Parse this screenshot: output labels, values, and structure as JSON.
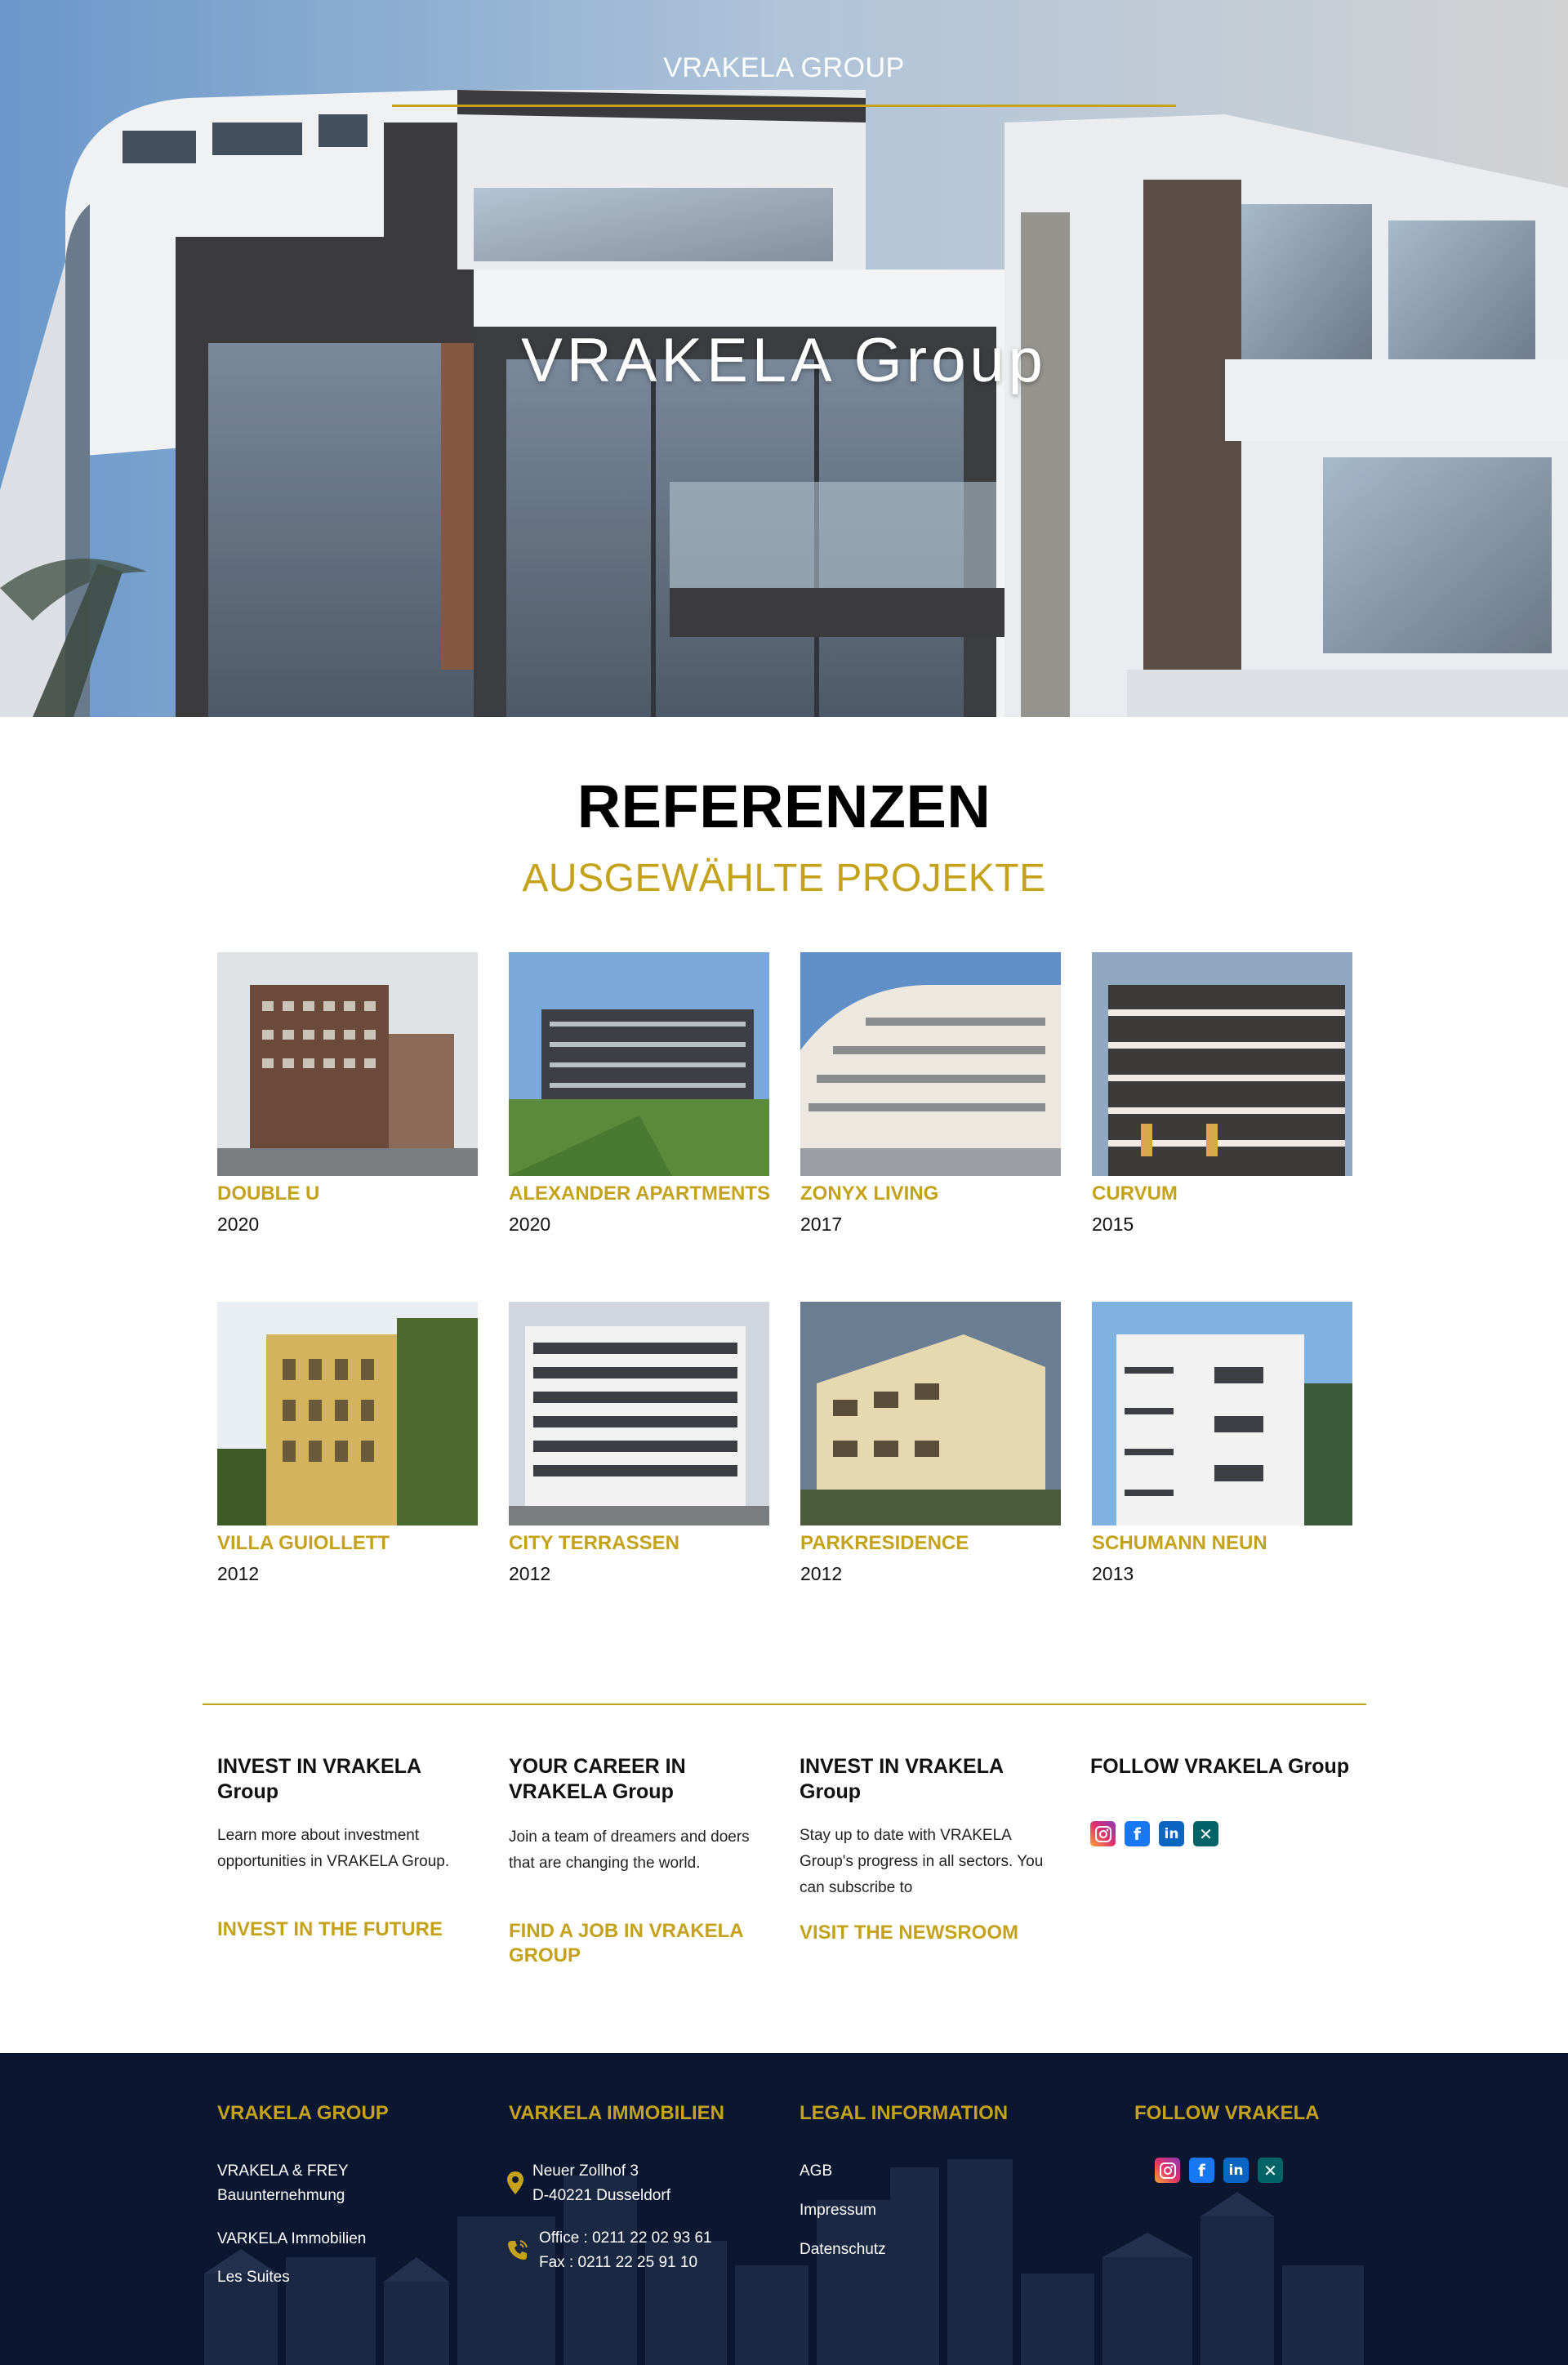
{
  "hero": {
    "brand": "VRAKELA GROUP",
    "title": "VRAKELA Group"
  },
  "references": {
    "title": "REFERENZEN",
    "subtitle": "AUSGEWÄHLTE PROJEKTE",
    "projects": [
      {
        "name": "DOUBLE U",
        "year": "2020"
      },
      {
        "name": "ALEXANDER APARTMENTS",
        "year": "2020"
      },
      {
        "name": "ZONYX LIVING",
        "year": "2017"
      },
      {
        "name": "CURVUM",
        "year": "2015"
      },
      {
        "name": "VILLA GUIOLLETT",
        "year": "2012"
      },
      {
        "name": "CITY TERRASSEN",
        "year": "2012"
      },
      {
        "name": "PARKRESIDENCE",
        "year": "2012"
      },
      {
        "name": "SCHUMANN NEUN",
        "year": "2013"
      }
    ]
  },
  "info": {
    "invest": {
      "title": "INVEST IN VRAKELA Group",
      "text": "Learn more about investment opportunities in VRAKELA Group.",
      "cta": "INVEST IN THE FUTURE"
    },
    "career": {
      "title": "YOUR CAREER IN VRAKELA Group",
      "text": "Join a team of dreamers and doers that are changing the world.",
      "cta": "FIND A JOB IN VRAKELA GROUP"
    },
    "news": {
      "title": "INVEST IN VRAKELA Group",
      "text": "Stay up to date with VRAKELA Group's progress in all sectors. You can subscribe to",
      "cta": "VISIT THE NEWSROOM"
    },
    "follow": {
      "title": "FOLLOW VRAKELA Group",
      "icons": [
        "instagram-icon",
        "facebook-icon",
        "linkedin-icon",
        "xing-icon"
      ]
    }
  },
  "footer": {
    "group": {
      "title": "VRAKELA GROUP",
      "link1_line1": "VRAKELA & FREY",
      "link1_line2": "Bauunternehmung",
      "link2": "VARKELA Immobilien",
      "link3": "Les Suites"
    },
    "immobilien": {
      "title": "VARKELA IMMOBILIEN",
      "address_line1": "Neuer Zollhof 3",
      "address_line2": "D-40221 Dusseldorf",
      "office": "Office : 0211 22 02 93 61",
      "fax": "Fax : 0211 22 25 91 10"
    },
    "legal": {
      "title": "LEGAL INFORMATION",
      "agb": "AGB",
      "impressum": "Impressum",
      "datenschutz": "Datenschutz"
    },
    "follow": {
      "title": "FOLLOW VRAKELA"
    }
  },
  "colors": {
    "accent": "#c4a21b",
    "footer_bg": "#0b1630",
    "instagram": "#e1306c",
    "facebook": "#1877f2",
    "linkedin": "#0a66c2",
    "xing": "#026466"
  }
}
